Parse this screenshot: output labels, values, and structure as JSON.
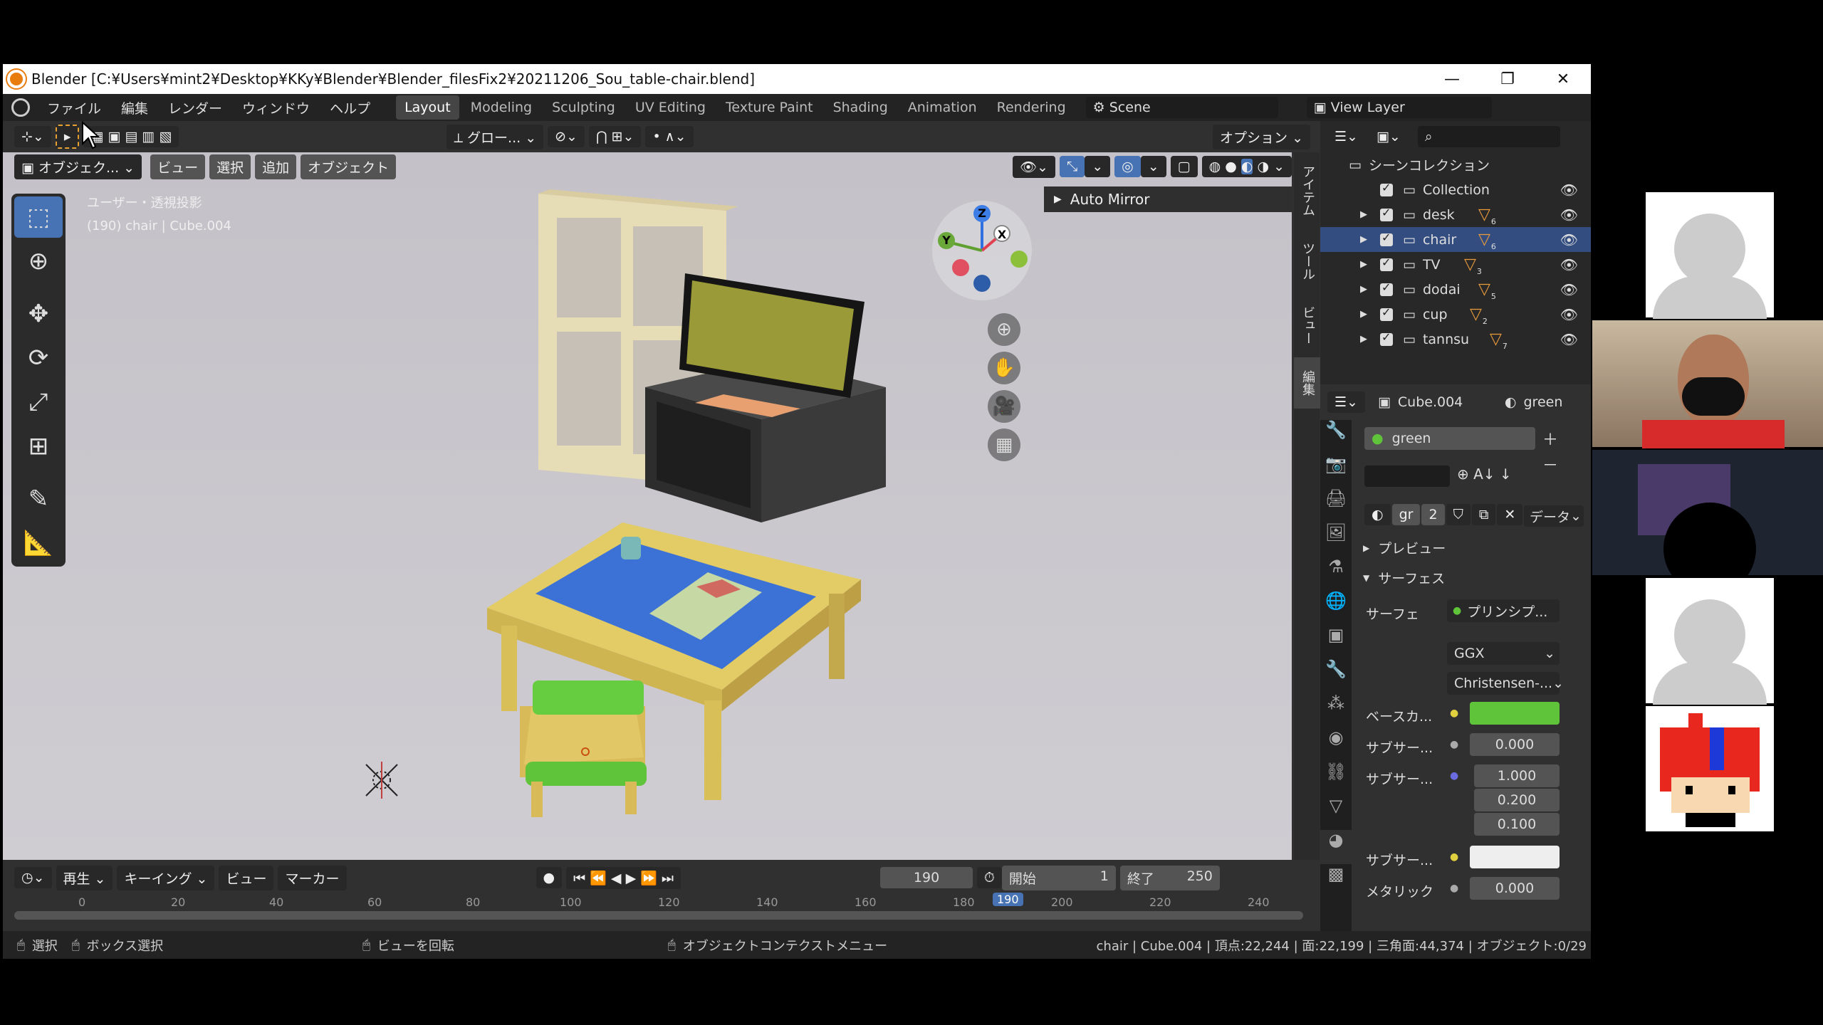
{
  "titlebar": {
    "title": "Blender [C:¥Users¥mint2¥Desktop¥KKy¥Blender¥Blender_filesFix2¥20211206_Sou_table-chair.blend]"
  },
  "menu": [
    "ファイル",
    "編集",
    "レンダー",
    "ウィンドウ",
    "ヘルプ"
  ],
  "workspaces": [
    "Layout",
    "Modeling",
    "Sculpting",
    "UV Editing",
    "Texture Paint",
    "Shading",
    "Animation",
    "Rendering"
  ],
  "active_workspace": "Layout",
  "scene": "Scene",
  "view_layer": "View Layer",
  "header": {
    "transform": "グロー...",
    "options": "オプション"
  },
  "viewport_header": {
    "mode": "オブジェク...",
    "view": "ビュー",
    "select": "選択",
    "add": "追加",
    "object": "オブジェクト"
  },
  "viewport_info": {
    "line1": "ユーザー・透視投影",
    "line2": "(190) chair | Cube.004"
  },
  "auto_mirror": "Auto Mirror",
  "gizmo": {
    "x": "X",
    "y": "Y",
    "z": "Z"
  },
  "side_tabs": [
    "アイテム",
    "ツール",
    "ビュー",
    "編集"
  ],
  "timeline": {
    "play": "再生",
    "keying": "キーイング",
    "view": "ビュー",
    "marker": "マーカー",
    "frame": "190",
    "start_label": "開始",
    "start": "1",
    "end_label": "終了",
    "end": "250",
    "ticks": [
      "0",
      "20",
      "40",
      "60",
      "80",
      "100",
      "120",
      "140",
      "160",
      "180",
      "190",
      "200",
      "220",
      "240"
    ]
  },
  "status": {
    "select": "選択",
    "box": "ボックス選択",
    "rotate": "ビューを回転",
    "ctx": "オブジェクトコンテクストメニュー",
    "stats": "chair | Cube.004 | 頂点:22,244 | 面:22,199 | 三角面:44,374 | オブジェクト:0/29"
  },
  "outliner": {
    "title": "シーンコレクション",
    "items": [
      {
        "name": "Collection",
        "count": ""
      },
      {
        "name": "desk",
        "count": "6"
      },
      {
        "name": "chair",
        "count": "6"
      },
      {
        "name": "TV",
        "count": "3"
      },
      {
        "name": "dodai",
        "count": "5"
      },
      {
        "name": "cup",
        "count": "2"
      },
      {
        "name": "tannsu",
        "count": "7"
      }
    ]
  },
  "props": {
    "object": "Cube.004",
    "material": "green",
    "slot": "green",
    "mat_short": "gr",
    "users": "2",
    "data": "データ",
    "preview": "プレビュー",
    "surface_panel": "サーフェス",
    "surface_label": "サーフェ",
    "surface_value": "プリンシプ...",
    "distribution": "GGX",
    "subsurface_method": "Christensen-...",
    "base_color_label": "ベースカ...",
    "base_color": "#5fc43a",
    "subsurface_label": "サブサー...",
    "subsurface_value": "0.000",
    "radius_label": "サブサー...",
    "radius": [
      "1.000",
      "0.200",
      "0.100"
    ],
    "ss_color_label": "サブサー...",
    "metallic_label": "メタリック",
    "metallic": "0.000"
  }
}
